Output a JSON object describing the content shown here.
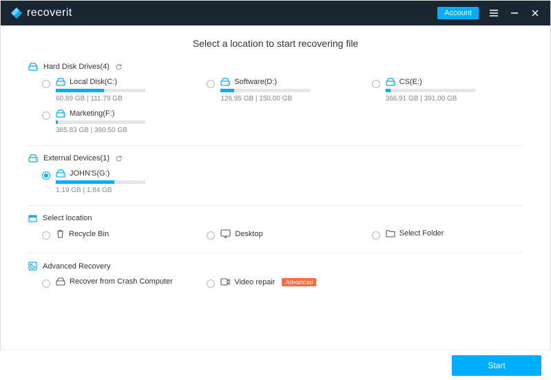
{
  "brand": "recoverit",
  "header": {
    "account_label": "Account"
  },
  "title": "Select a location to start recovering file",
  "sections": {
    "hdd": {
      "label": "Hard Disk Drives(4)"
    },
    "ext": {
      "label": "External Devices(1)"
    },
    "sel": {
      "label": "Select location"
    },
    "adv": {
      "label": "Advanced Recovery"
    }
  },
  "drives": {
    "c": {
      "label": "Local Disk(C:)",
      "usage": "60.89  GB | 111.79  GB",
      "pct": 54
    },
    "d": {
      "label": "Software(D:)",
      "usage": "126.95  GB | 150.00  GB",
      "pct": 15
    },
    "e": {
      "label": "CS(E:)",
      "usage": "366.91  GB | 391.00  GB",
      "pct": 6
    },
    "f": {
      "label": "Marketing(F:)",
      "usage": "385.83  GB | 390.50  GB",
      "pct": 2
    },
    "g": {
      "label": "JOHN'S(G:)",
      "usage": "1.19  GB | 1.84  GB",
      "pct": 65
    }
  },
  "locations": {
    "recycle": {
      "label": "Recycle Bin"
    },
    "desktop": {
      "label": "Desktop"
    },
    "folder": {
      "label": "Select Folder"
    }
  },
  "advanced": {
    "crash": {
      "label": "Recover from Crash Computer"
    },
    "video": {
      "label": "Video repair",
      "badge": "Advanced"
    }
  },
  "footer": {
    "start_label": "Start"
  }
}
